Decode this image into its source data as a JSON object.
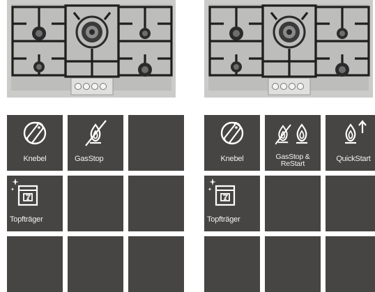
{
  "colors": {
    "tile": "#474543",
    "icon": "#ffffff",
    "steel": "#c9c9c7",
    "grate": "#2a2a2a"
  },
  "left_panel": {
    "features": [
      {
        "label": "Knebel",
        "icon": "knob-icon"
      },
      {
        "label": "GasStop",
        "icon": "flame-crossed-icon"
      },
      {
        "label": "",
        "icon": ""
      },
      {
        "label": "Topfträger",
        "icon": "dishwasher-icon"
      },
      {
        "label": "",
        "icon": ""
      },
      {
        "label": "",
        "icon": ""
      },
      {
        "label": "",
        "icon": ""
      },
      {
        "label": "",
        "icon": ""
      },
      {
        "label": "",
        "icon": ""
      }
    ]
  },
  "right_panel": {
    "features": [
      {
        "label": "Knebel",
        "icon": "knob-icon"
      },
      {
        "label": "GasStop & ReStart",
        "icon": "flame-crossed-restart-icon"
      },
      {
        "label": "QuickStart",
        "icon": "flame-up-arrow-icon"
      },
      {
        "label": "Topfträger",
        "icon": "dishwasher-icon"
      },
      {
        "label": "",
        "icon": ""
      },
      {
        "label": "",
        "icon": ""
      },
      {
        "label": "",
        "icon": ""
      },
      {
        "label": "",
        "icon": ""
      },
      {
        "label": "",
        "icon": ""
      }
    ]
  }
}
